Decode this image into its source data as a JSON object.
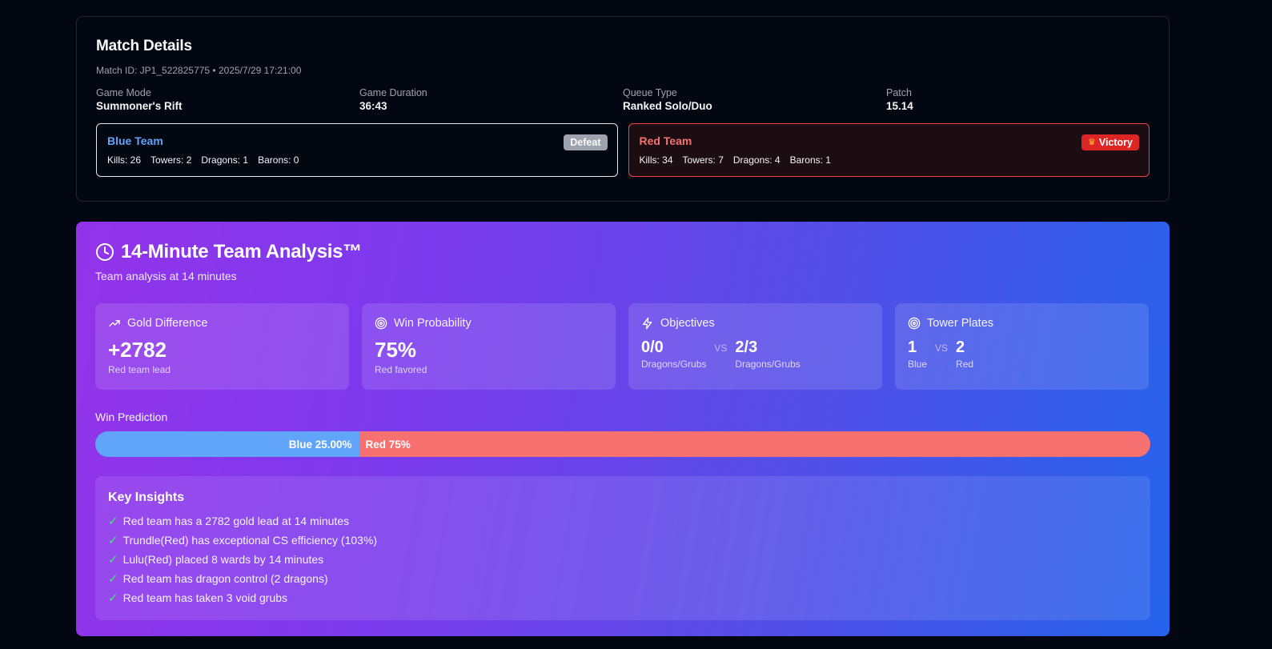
{
  "match": {
    "title": "Match Details",
    "meta": "Match ID: JP1_522825775 • 2025/7/29 17:21:00",
    "info": [
      {
        "label": "Game Mode",
        "value": "Summoner's Rift"
      },
      {
        "label": "Game Duration",
        "value": "36:43"
      },
      {
        "label": "Queue Type",
        "value": "Ranked Solo/Duo"
      },
      {
        "label": "Patch",
        "value": "15.14"
      }
    ],
    "blue": {
      "name": "Blue Team",
      "result": "Defeat",
      "kills": "Kills: 26",
      "towers": "Towers: 2",
      "dragons": "Dragons: 1",
      "barons": "Barons: 0"
    },
    "red": {
      "name": "Red Team",
      "result": "Victory",
      "kills": "Kills: 34",
      "towers": "Towers: 7",
      "dragons": "Dragons: 4",
      "barons": "Barons: 1"
    }
  },
  "analysis": {
    "title": "14-Minute Team Analysis™",
    "subtitle": "Team analysis at 14 minutes",
    "gold": {
      "label": "Gold Difference",
      "value": "+2782",
      "note": "Red team lead"
    },
    "winprob": {
      "label": "Win Probability",
      "value": "75%",
      "note": "Red favored"
    },
    "objectives": {
      "label": "Objectives",
      "left": "0/0",
      "left_label": "Dragons/Grubs",
      "vs": "VS",
      "right": "2/3",
      "right_label": "Dragons/Grubs"
    },
    "plates": {
      "label": "Tower Plates",
      "left": "1",
      "left_label": "Blue",
      "vs": "VS",
      "right": "2",
      "right_label": "Red"
    },
    "prediction": {
      "label": "Win Prediction",
      "blue_text": "Blue 25.00%",
      "red_text": "Red 75%",
      "blue_fraction": 0.25
    },
    "insights": {
      "title": "Key Insights",
      "items": [
        "Red team has a 2782 gold lead at 14 minutes",
        "Trundle(Red) has exceptional CS efficiency (103%)",
        "Lulu(Red) placed 8 wards by 14 minutes",
        "Red team has dragon control (2 dragons)",
        "Red team has taken 3 void grubs"
      ]
    }
  },
  "icons": {
    "clock": "clock-icon",
    "trend": "trending-up-icon",
    "target": "target-icon",
    "bolt": "lightning-icon",
    "check": "check-icon",
    "crown": "crown-icon"
  },
  "colors": {
    "blue_team": "#60a5fa",
    "red_team": "#f87171",
    "victory": "#dc2626",
    "defeat": "#9ca3af",
    "check": "#4ade80"
  }
}
